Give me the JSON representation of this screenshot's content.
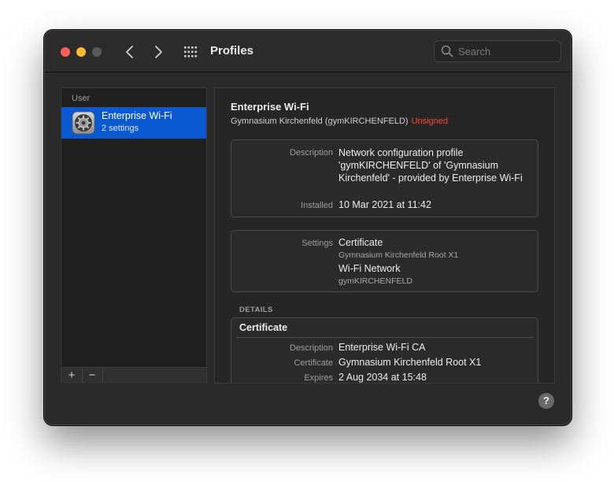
{
  "window": {
    "title": "Profiles"
  },
  "search": {
    "placeholder": "Search"
  },
  "sidebar": {
    "section_label": "User",
    "items": [
      {
        "title": "Enterprise Wi-Fi",
        "subtitle": "2 settings",
        "selected": true
      }
    ],
    "toolbar": {
      "add_label": "+",
      "remove_label": "−"
    }
  },
  "detail": {
    "title": "Enterprise Wi-Fi",
    "organization": "Gymnasium Kirchenfeld (gymKIRCHENFELD)",
    "signature_status": "Unsigned",
    "info": {
      "description_label": "Description",
      "description_value": "Network configuration profile 'gymKIRCHENFELD' of 'Gymnasium Kirchenfeld' - provided by Enterprise Wi-Fi",
      "installed_label": "Installed",
      "installed_value": "10 Mar 2021 at 11:42"
    },
    "settings": {
      "label": "Settings",
      "items": [
        {
          "name": "Certificate",
          "detail": "Gymnasium Kirchenfeld Root X1"
        },
        {
          "name": "Wi-Fi Network",
          "detail": "gymKIRCHENFELD"
        }
      ]
    },
    "details_header": "DETAILS",
    "certificate": {
      "header": "Certificate",
      "rows": [
        {
          "label": "Description",
          "value": "Enterprise Wi-Fi CA"
        },
        {
          "label": "Certificate",
          "value": "Gymnasium Kirchenfeld Root X1"
        },
        {
          "label": "Expires",
          "value": "2 Aug 2034 at 15:48"
        }
      ]
    }
  },
  "help": {
    "label": "?"
  },
  "colors": {
    "selection": "#0b59d0",
    "unsigned": "#ff453a",
    "close": "#fe5f57",
    "minimize": "#febc2e"
  },
  "icons": [
    "back-icon",
    "forward-icon",
    "grid-icon",
    "search-icon",
    "profile-gear-icon"
  ]
}
